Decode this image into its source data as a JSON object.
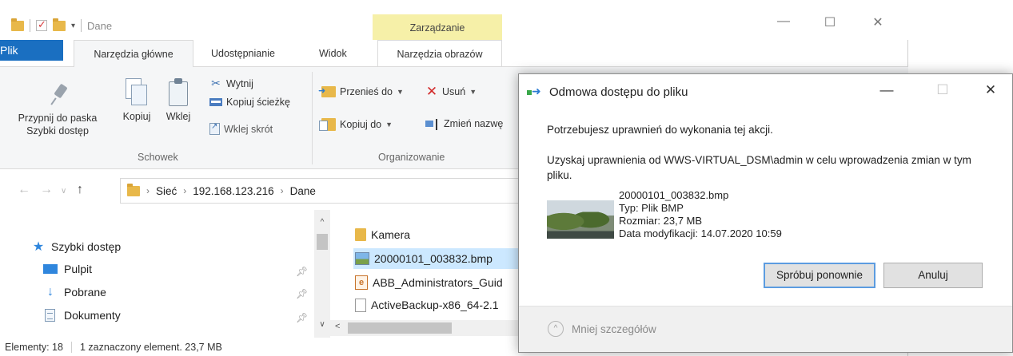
{
  "explorer": {
    "title": "Dane",
    "context_group": "Zarządzanie",
    "tabs": {
      "file": "Plik",
      "home": "Narzędzia główne",
      "share": "Udostępnianie",
      "view": "Widok",
      "picture_tools": "Narzędzia obrazów"
    },
    "ribbon": {
      "clipboard": {
        "label": "Schowek",
        "pin": "Przypnij do paska Szybki dostęp",
        "copy": "Kopiuj",
        "paste": "Wklej",
        "cut": "Wytnij",
        "copy_path": "Kopiuj ścieżkę",
        "paste_shortcut": "Wklej skrót"
      },
      "organize": {
        "label": "Organizowanie",
        "move_to": "Przenieś do",
        "copy_to": "Kopiuj do",
        "delete": "Usuń",
        "rename": "Zmień nazwę"
      }
    },
    "breadcrumb": [
      "Sieć",
      "192.168.123.216",
      "Dane"
    ],
    "nav": {
      "quick_access": "Szybki dostęp",
      "items": [
        "Pulpit",
        "Pobrane",
        "Dokumenty"
      ]
    },
    "files": [
      {
        "name": "Kamera",
        "icon": "folder-icon"
      },
      {
        "name": "20000101_003832.bmp",
        "icon": "image-file-icon"
      },
      {
        "name": "ABB_Administrators_Guid",
        "icon": "pdf-file-icon"
      },
      {
        "name": "ActiveBackup-x86_64-2.1",
        "icon": "file-icon"
      }
    ],
    "status": {
      "count": "Elementy: 18",
      "selection": "1 zaznaczony element. 23,7 MB"
    },
    "colors": {
      "accent": "#1a6fc1",
      "context_tab": "#f6f0a8",
      "selection": "#cce8ff"
    }
  },
  "dialog": {
    "title": "Odmowa dostępu do pliku",
    "message1": "Potrzebujesz uprawnień do wykonania tej akcji.",
    "message2": "Uzyskaj uprawnienia od WWS-VIRTUAL_DSM\\admin w celu wprowadzenia zmian w tym pliku.",
    "file": {
      "name": "20000101_003832.bmp",
      "type": "Typ: Plik BMP",
      "size": "Rozmiar: 23,7 MB",
      "modified": "Data modyfikacji: 14.07.2020 10:59"
    },
    "retry": "Spróbuj ponownie",
    "cancel": "Anuluj",
    "less_details": "Mniej szczegółów"
  }
}
